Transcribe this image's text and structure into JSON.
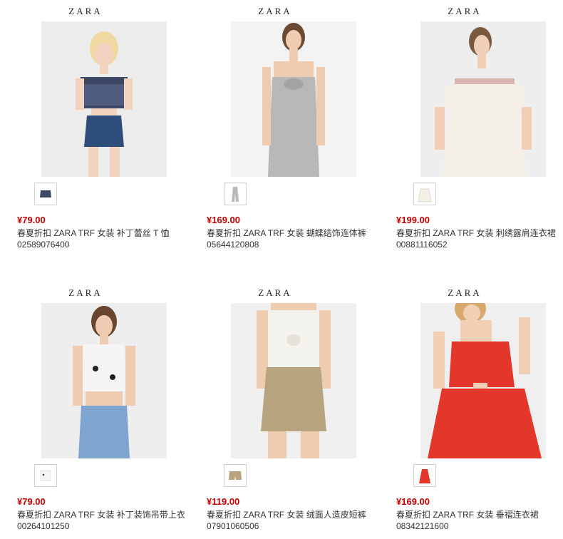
{
  "products": [
    {
      "brand": "ZARA",
      "price": "¥79.00",
      "name": "春夏折扣 ZARA TRF 女装 补丁蕾丝 T 恤",
      "code": "02589076400",
      "swatch_color": "#3d4766",
      "photo_bg": "#ececec"
    },
    {
      "brand": "ZARA",
      "price": "¥169.00",
      "name": "春夏折扣 ZARA TRF 女装 蝴蝶结饰连体裤",
      "code": "05644120808",
      "swatch_color": "#b8b8b8",
      "photo_bg": "#f3f3f3"
    },
    {
      "brand": "ZARA",
      "price": "¥199.00",
      "name": "春夏折扣 ZARA TRF 女装 刺绣露肩连衣裙",
      "code": "00881116052",
      "swatch_color": "#f3efe6",
      "photo_bg": "#eeeeee"
    },
    {
      "brand": "ZARA",
      "price": "¥79.00",
      "name": "春夏折扣 ZARA TRF 女装 补丁装饰吊带上衣",
      "code": "00264101250",
      "swatch_color": "#f5f5f5",
      "photo_bg": "#eeeeee"
    },
    {
      "brand": "ZARA",
      "price": "¥119.00",
      "name": "春夏折扣 ZARA TRF 女装 绒面人造皮短裤",
      "code": "07901060506",
      "swatch_color": "#b8a37f",
      "photo_bg": "#f0f0f0"
    },
    {
      "brand": "ZARA",
      "price": "¥169.00",
      "name": "春夏折扣 ZARA TRF 女装 垂褶连衣裙",
      "code": "08342121600",
      "swatch_color": "#e2372a",
      "photo_bg": "#efefef"
    }
  ],
  "colors": {
    "price": "#c40000",
    "text": "#333333",
    "swatch_border": "#d0d0d0"
  }
}
